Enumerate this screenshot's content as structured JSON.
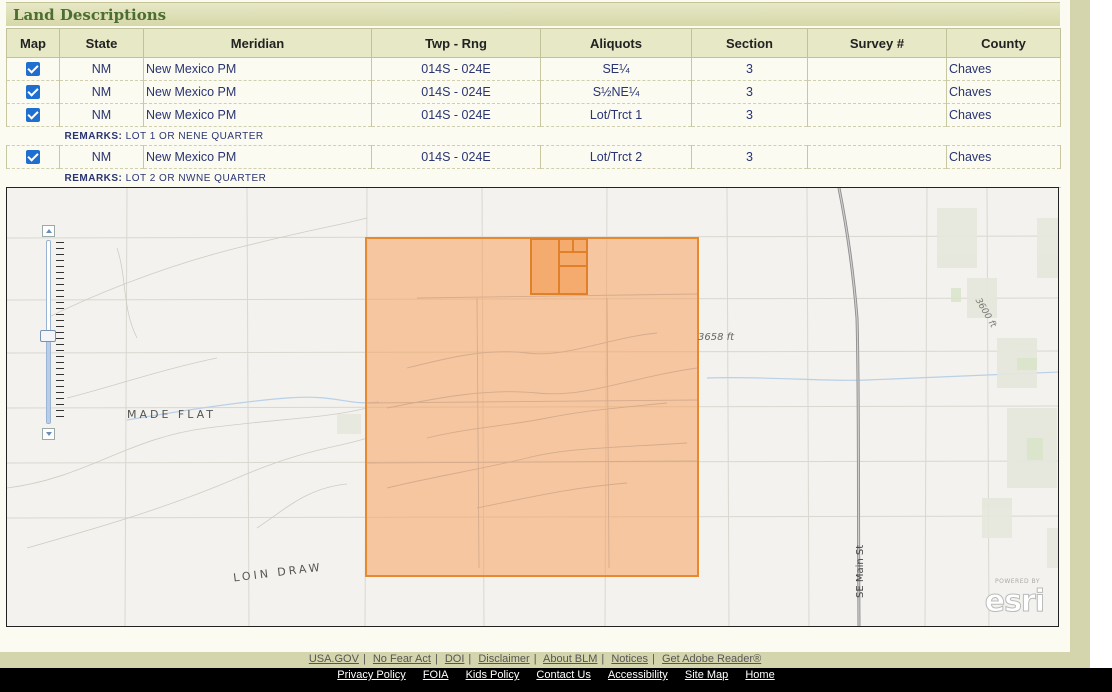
{
  "section_title": "Land Descriptions",
  "table": {
    "headers": [
      "Map",
      "State",
      "Meridian",
      "Twp - Rng",
      "Aliquots",
      "Section",
      "Survey #",
      "County"
    ],
    "rows": [
      {
        "state": "NM",
        "meridian": "New Mexico PM",
        "twp_rng": "014S - 024E",
        "aliquots": "SE¼",
        "section": "3",
        "survey": "",
        "county": "Chaves",
        "checked": true
      },
      {
        "state": "NM",
        "meridian": "New Mexico PM",
        "twp_rng": "014S - 024E",
        "aliquots": "S½NE¼",
        "section": "3",
        "survey": "",
        "county": "Chaves",
        "checked": true
      },
      {
        "state": "NM",
        "meridian": "New Mexico PM",
        "twp_rng": "014S - 024E",
        "aliquots": "Lot/Trct 1",
        "section": "3",
        "survey": "",
        "county": "Chaves",
        "checked": true
      },
      {
        "state": "NM",
        "meridian": "New Mexico PM",
        "twp_rng": "014S - 024E",
        "aliquots": "Lot/Trct 2",
        "section": "3",
        "survey": "",
        "county": "Chaves",
        "checked": true
      }
    ],
    "remarks_label": "REMARKS:",
    "remarks": [
      "LOT 1 OR NENE QUARTER",
      "LOT 2 OR NWNE QUARTER"
    ]
  },
  "map": {
    "labels": {
      "made_flat": "MADE FLAT",
      "loin_draw": "LOIN DRAW",
      "elevation": "3658 ft",
      "elevation_2": "3600 ft",
      "road": "SE Main St"
    },
    "attribution": {
      "powered": "POWERED BY",
      "brand": "esri"
    },
    "zoom_level_fraction": 0.48,
    "parcel_color": "#f5a35f",
    "parcel_border_color": "#e8892f"
  },
  "footer": {
    "row1": [
      "USA.GOV",
      "No Fear Act",
      "DOI",
      "Disclaimer",
      "About BLM",
      "Notices",
      "Get Adobe Reader®"
    ],
    "row2": [
      "Privacy Policy",
      "FOIA",
      "Kids Policy",
      "Contact Us",
      "Accessibility",
      "Site Map",
      "Home"
    ]
  }
}
